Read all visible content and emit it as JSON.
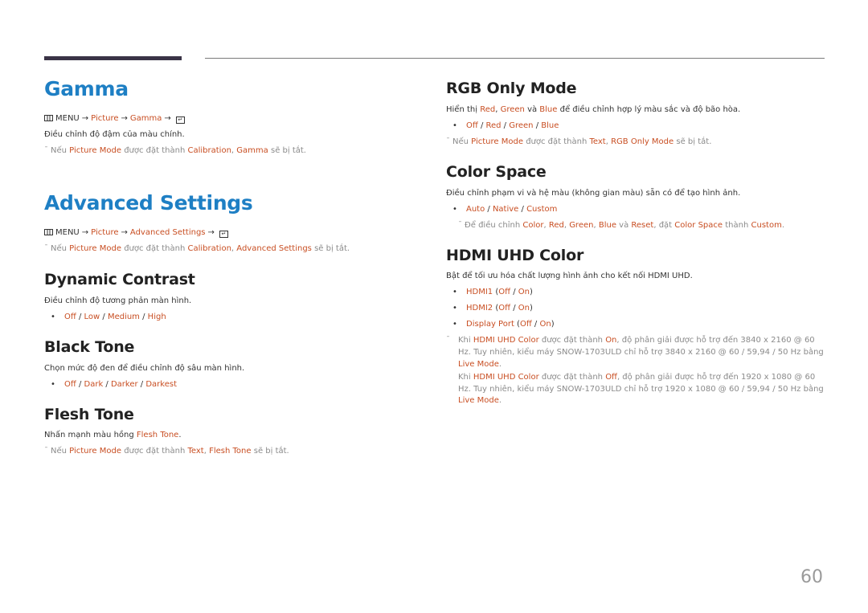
{
  "page_number": "60",
  "left": {
    "gamma": {
      "title": "Gamma",
      "menu_path": {
        "menu": "MENU",
        "steps": [
          "Picture",
          "Gamma"
        ],
        "arrow": "→"
      },
      "description": "Điều chỉnh độ đậm của màu chính.",
      "note": {
        "prefix": "Nếu",
        "setting": "Picture Mode",
        "middle": "được đặt thành",
        "value": "Calibration",
        "comma": ",",
        "feature": "Gamma",
        "suffix": "sẽ bị tắt."
      }
    },
    "advanced": {
      "title": "Advanced Settings",
      "menu_path": {
        "menu": "MENU",
        "steps": [
          "Picture",
          "Advanced Settings"
        ],
        "arrow": "→"
      },
      "note": {
        "prefix": "Nếu",
        "setting": "Picture Mode",
        "middle": "được đặt thành",
        "value": "Calibration",
        "comma": ",",
        "feature": "Advanced Settings",
        "suffix": "sẽ bị tắt."
      }
    },
    "dynamic_contrast": {
      "title": "Dynamic Contrast",
      "description": "Điều chỉnh độ tương phản màn hình.",
      "options": [
        "Off",
        "Low",
        "Medium",
        "High"
      ]
    },
    "black_tone": {
      "title": "Black Tone",
      "description": "Chọn mức độ đen để điều chỉnh độ sâu màn hình.",
      "options": [
        "Off",
        "Dark",
        "Darker",
        "Darkest"
      ]
    },
    "flesh_tone": {
      "title": "Flesh Tone",
      "description_prefix": "Nhấn mạnh màu hồng",
      "description_hl": "Flesh Tone",
      "description_suffix": ".",
      "note": {
        "prefix": "Nếu",
        "setting": "Picture Mode",
        "middle": "được đặt thành",
        "value": "Text",
        "comma": ",",
        "feature": "Flesh Tone",
        "suffix": "sẽ bị tắt."
      }
    }
  },
  "right": {
    "rgb_only": {
      "title": "RGB Only Mode",
      "desc": {
        "p1": "Hiển thị",
        "red": "Red",
        "comma": ",",
        "green": "Green",
        "and": "và",
        "blue": "Blue",
        "p2": "để điều chỉnh hợp lý màu sắc và độ bão hòa."
      },
      "options": [
        "Off",
        "Red",
        "Green",
        "Blue"
      ],
      "note": {
        "prefix": "Nếu",
        "setting": "Picture Mode",
        "middle": "được đặt thành",
        "value": "Text",
        "comma": ",",
        "feature": "RGB Only Mode",
        "suffix": "sẽ bị tắt."
      }
    },
    "color_space": {
      "title": "Color Space",
      "description": "Điều chỉnh phạm vi và hệ màu (không gian màu) sẵn có để tạo hình ảnh.",
      "options": [
        "Auto",
        "Native",
        "Custom"
      ],
      "note": {
        "prefix": "Để điều chỉnh",
        "items": [
          "Color",
          "Red",
          "Green",
          "Blue"
        ],
        "and": "và",
        "reset": "Reset",
        "middle": ", đặt",
        "setting": "Color Space",
        "to": "thành",
        "value": "Custom",
        "end": "."
      }
    },
    "hdmi_uhd": {
      "title": "HDMI UHD Color",
      "description": "Bật để tối ưu hóa chất lượng hình ảnh cho kết nối HDMI UHD.",
      "ports": [
        {
          "name": "HDMI1",
          "options": [
            "Off",
            "On"
          ]
        },
        {
          "name": "HDMI2",
          "options": [
            "Off",
            "On"
          ]
        },
        {
          "name": "Display Port",
          "options": [
            "Off",
            "On"
          ]
        }
      ],
      "notes": [
        {
          "p1": "Khi",
          "feature": "HDMI UHD Color",
          "p2": "được đặt thành",
          "value": "On",
          "p3": ", độ phân giải được hỗ trợ đến 3840 x 2160 @ 60 Hz. Tuy nhiên, kiểu máy SNOW-1703ULD chỉ hỗ trợ 3840 x 2160 @ 60 / 59,94 / 50 Hz bằng",
          "mode": "Live Mode",
          "end": "."
        },
        {
          "p1": "Khi",
          "feature": "HDMI UHD Color",
          "p2": "được đặt thành",
          "value": "Off",
          "p3": ", độ phân giải được hỗ trợ đến 1920 x 1080 @ 60 Hz. Tuy nhiên, kiểu máy SNOW-1703ULD chỉ hỗ trợ 1920 x 1080 @ 60 / 59,94 / 50 Hz bằng",
          "mode": "Live Mode",
          "end": "."
        }
      ]
    }
  }
}
